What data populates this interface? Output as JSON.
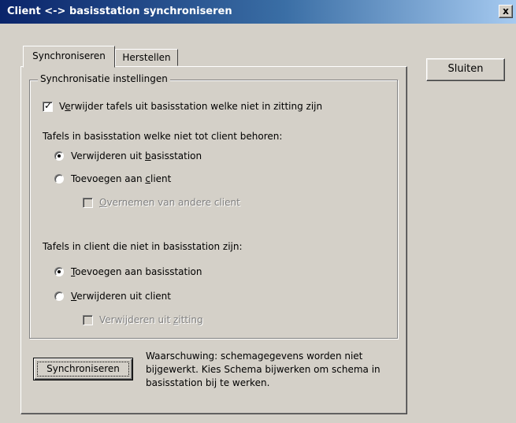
{
  "window": {
    "title": "Client <-> basisstation synchroniseren",
    "close_glyph": "x"
  },
  "tabs": [
    {
      "label": "Synchroniseren",
      "active": true
    },
    {
      "label": "Herstellen",
      "active": false
    }
  ],
  "group": {
    "legend": "Synchronisatie instellingen",
    "remove_tables_checkbox": {
      "pre": "V",
      "accel": "e",
      "post": "rwijder tafels uit basisstation welke niet in zitting zijn",
      "checked": true
    },
    "section1": {
      "heading": "Tafels in basisstation welke niet tot client behoren:",
      "option_remove": {
        "pre": "Verwijderen uit ",
        "accel": "b",
        "post": "asisstation",
        "selected": true
      },
      "option_add": {
        "pre": "Toevoegen aan ",
        "accel": "c",
        "post": "lient",
        "selected": false
      },
      "take_over_checkbox": {
        "pre": "",
        "accel": "O",
        "post": "vernemen van andere client",
        "checked": false,
        "enabled": false
      }
    },
    "section2": {
      "heading": "Tafels in client die niet in basisstation zijn:",
      "option_add": {
        "pre": "",
        "accel": "T",
        "post": "oevoegen aan basisstation",
        "selected": true
      },
      "option_remove": {
        "pre": "",
        "accel": "V",
        "post": "erwijderen uit client",
        "selected": false
      },
      "remove_session_checkbox": {
        "pre": "Verwijderen uit ",
        "accel": "z",
        "post": "itting",
        "checked": false,
        "enabled": false
      }
    }
  },
  "sync_button": {
    "label": "Synchroniseren"
  },
  "warning": {
    "lines": [
      "Waarschuwing: schemagegevens worden niet",
      "bijgewerkt. Kies Schema bijwerken om schema in",
      "basisstation bij te werken."
    ]
  },
  "close_button": {
    "label": "Sluiten"
  }
}
